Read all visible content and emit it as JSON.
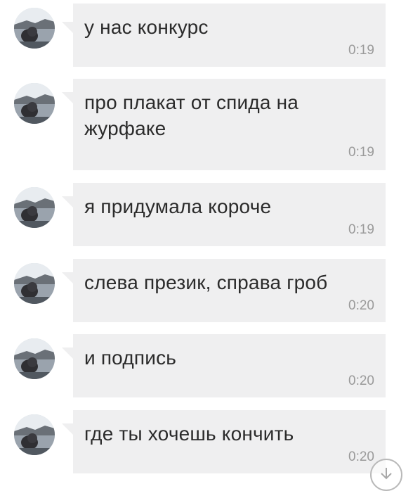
{
  "messages": [
    {
      "text": "у нас конкурс",
      "time": "0:19"
    },
    {
      "text": "про плакат от спида на журфаке",
      "time": "0:19"
    },
    {
      "text": "я придумала короче",
      "time": "0:19"
    },
    {
      "text": "слева презик, справа гроб",
      "time": "0:20"
    },
    {
      "text": "и подпись",
      "time": "0:20"
    },
    {
      "text": "где ты хочешь кончить",
      "time": "0:20"
    }
  ],
  "icons": {
    "avatar": "user-avatar-photo",
    "scroll_down": "arrow-down-circle-icon"
  },
  "colors": {
    "bubble": "#efeff0",
    "text": "#2b2b2b",
    "time": "#9a9a9a"
  }
}
